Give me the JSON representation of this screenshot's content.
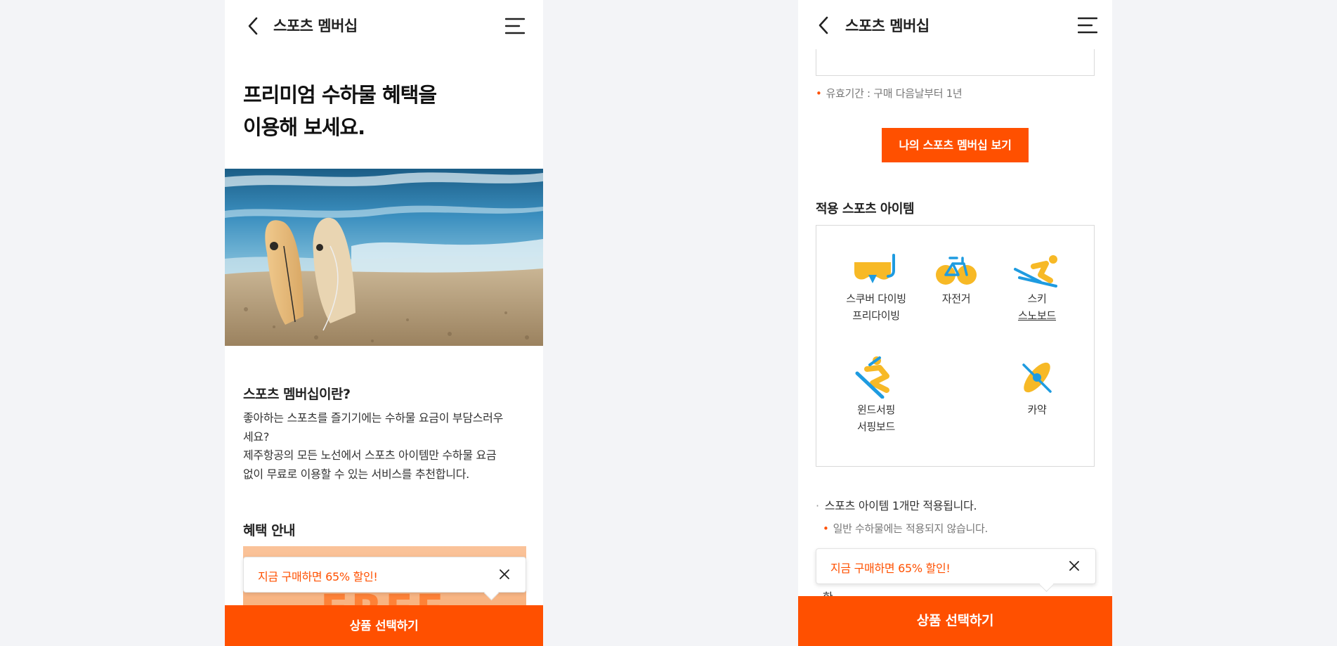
{
  "left_screen": {
    "header": {
      "title": "스포츠 멤버십",
      "back_icon": "chevron-left-icon",
      "menu_icon": "hamburger-menu-icon"
    },
    "hero": {
      "title_line1": "프리미엄 수하물 혜택을",
      "title_line2": "이용해 보세요."
    },
    "about": {
      "title": "스포츠 멤버십이란?",
      "line1": "좋아하는 스포츠를 즐기기에는 수하물 요금이 부담스러우",
      "line2": "세요?",
      "line3": "제주항공의 모든 노선에서 스포츠 아이템만 수하물 요금",
      "line4": "없이 무료로 이용할 수 있는 서비스를 추천합니다."
    },
    "benefits": {
      "title": "혜택 안내",
      "banner_text": "FREE"
    },
    "toast": {
      "text": "지금 구매하면 65% 할인!",
      "close_icon": "close-icon"
    },
    "cta_label": "상품 선택하기"
  },
  "right_screen": {
    "header": {
      "title": "스포츠 멤버십",
      "back_icon": "chevron-left-icon",
      "menu_icon": "hamburger-menu-icon"
    },
    "validity_note": "유효기간 : 구매 다음날부터 1년",
    "my_membership_button": "나의 스포츠 멤버십 보기",
    "items_title": "적용 스포츠 아이템",
    "items": [
      {
        "icon": "diving-mask-icon",
        "line1": "스쿠버 다이빙",
        "line2": "프리다이빙"
      },
      {
        "icon": "bicycle-icon",
        "line1": "자전거",
        "line2": ""
      },
      {
        "icon": "ski-icon",
        "line1": "스키",
        "line2": "스노보드"
      },
      {
        "icon": "surfing-icon",
        "line1": "윈드서핑",
        "line2": "서핑보드"
      },
      {
        "icon": "kayak-icon",
        "line1": "카약",
        "line2": ""
      }
    ],
    "info_1": "스포츠 아이템 1개만 적용됩니다.",
    "info_2": "일반 수하물에는 적용되지 않습니다.",
    "cut_text": "한",
    "toast": {
      "text": "지금 구매하면 65% 할인!",
      "close_icon": "close-icon"
    },
    "cta_label": "상품 선택하기"
  },
  "colors": {
    "accent": "#ff5000",
    "background": "#f3f4f7",
    "icon_yellow": "#f7b926",
    "icon_blue": "#1e9be0"
  }
}
